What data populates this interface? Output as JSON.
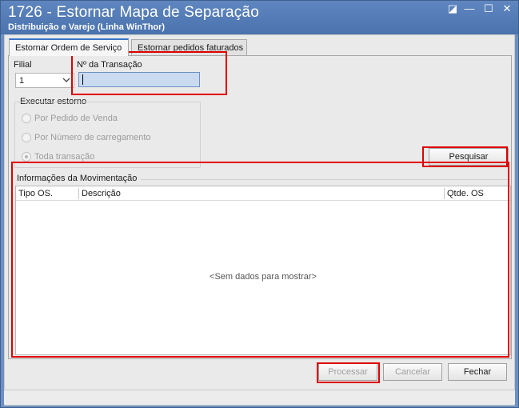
{
  "window": {
    "title": "1726 - Estornar Mapa de Separação",
    "subtitle": "Distribuição e Varejo (Linha WinThor)",
    "controls": {
      "restore": "◪",
      "minimize": "—",
      "maximize": "☐",
      "close": "✕"
    }
  },
  "tabs": [
    {
      "label": "Estornar Ordem de Serviço",
      "active": true
    },
    {
      "label": "Estornar pedidos faturados",
      "active": false
    }
  ],
  "form": {
    "filial_label": "Filial",
    "filial_value": "1",
    "transacao_label": "Nº da Transação",
    "transacao_value": ""
  },
  "estorno": {
    "group_label": "Executar estorno",
    "options": [
      {
        "label": "Por Pedido de Venda",
        "checked": false
      },
      {
        "label": "Por Número de carregamento",
        "checked": false
      },
      {
        "label": "Toda transação",
        "checked": true
      }
    ]
  },
  "buttons": {
    "pesquisar": "Pesquisar",
    "processar": "Processar",
    "cancelar": "Cancelar",
    "fechar": "Fechar"
  },
  "movimentacao": {
    "title": "Informações da Movimentação",
    "columns": [
      "Tipo OS.",
      "Descrição",
      "Qtde. OS"
    ],
    "empty_text": "<Sem dados para mostrar>"
  },
  "colors": {
    "highlight": "#e00000",
    "titlebar": "#4a72ad",
    "tab_accent": "#3a73c8"
  }
}
